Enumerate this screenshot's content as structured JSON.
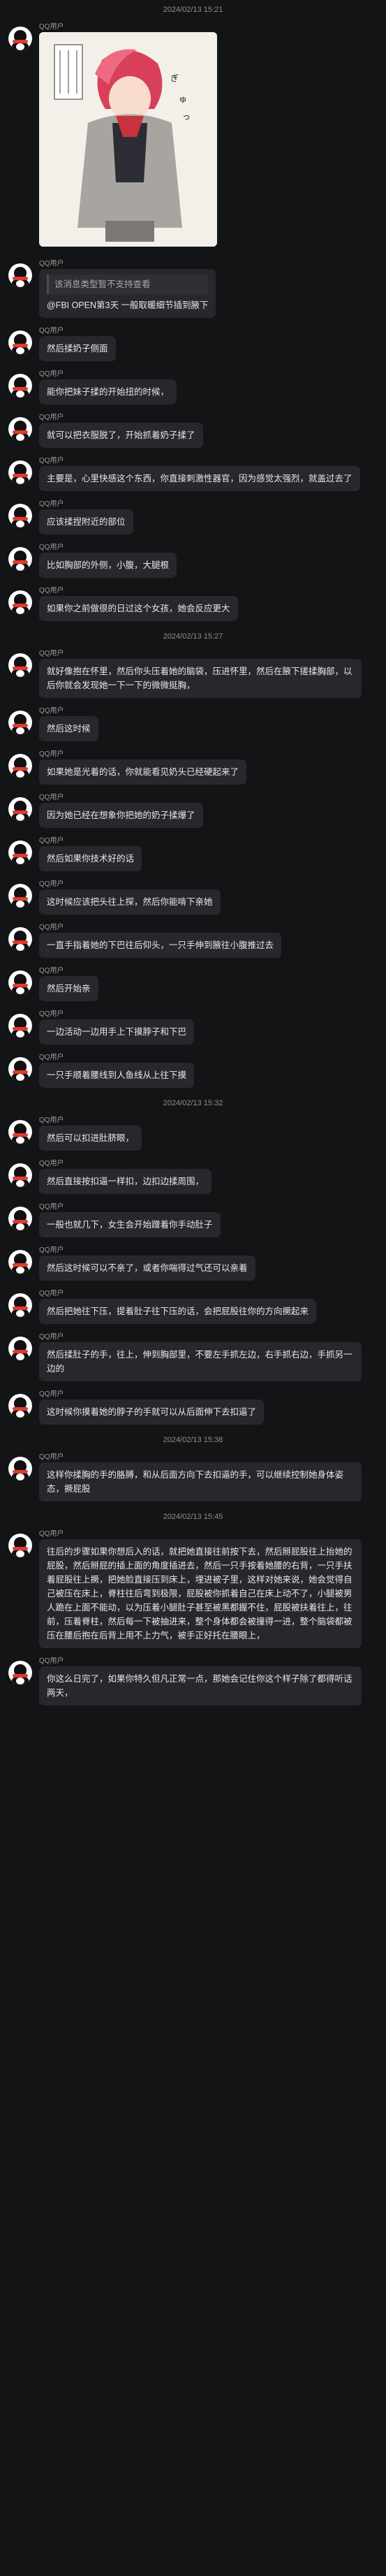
{
  "sender": "QQ用户",
  "timestamps": [
    "2024/02/13 15:21",
    "2024/02/13 15:27",
    "2024/02/13 15:32",
    "2024/02/13 15:38",
    "2024/02/13 15:45"
  ],
  "quote_notice": "该消息类型暂不支持查看",
  "messages": [
    "@FBI OPEN第3天 一般取暖细节插到腋下",
    "然后揉奶子侧面",
    "能你把妹子揉的开始扭的时候，",
    "就可以把衣服脱了，开始抓着奶子揉了",
    "主要是，心里快感这个东西，你直接刺激性器官，因为感觉太强烈，就盖过去了",
    "应该揉捏附近的部位",
    "比如胸部的外侧，小腹，大腿根",
    "如果你之前做很的日过这个女孩，她会反应更大",
    "就好像抱在怀里，然后你头压着她的脑袋，压进怀里，然后在腋下搓揉胸部，以后你就会发现她一下一下的微微挺胸，",
    "然后这时候",
    "如果她是光着的话，你就能看见奶头已经硬起来了",
    "因为她已经在想象你把她的奶子揉爆了",
    "然后如果你技术好的话",
    "这时候应该把头往上探，然后你能啃下亲她",
    "一直手指着她的下巴往后仰头，一只手伸到腋往小腹推过去",
    "然后开始亲",
    "一边活动一边用手上下摸脖子和下巴",
    "一只手顺着腰线到人鱼线从上往下摸",
    "然后可以扣进肚脐眼，",
    "然后直接按扣逼一样扣，边扣边揉周围，",
    "一般也就几下，女生会开始蹭着你手动肚子",
    "然后这时候可以不亲了，或者你喘得过气还可以亲着",
    "然后把她往下压，提着肚子往下压的话，会把屁股往你的方向撅起来",
    "然后揉肚子的手，往上，伸到胸部里，不要左手抓左边，右手抓右边，手抓另一边的",
    "这时候你摸着她的脖子的手就可以从后面伸下去扣逼了",
    "这样你揉胸的手的胳膊，和从后面方向下去扣逼的手，可以继续控制她身体姿态，撅屁股",
    "往后的步骤如果你想后入的话，就把她直接往前按下去，然后掰屁股往上抬她的屁股，然后掰屁的插上面的角度插进去，然后一只手按着她腰的右背，一只手扶着屁股往上撅，把她脸直接压到床上，埋进被子里，这样对她来说，她会觉得自己被压在床上，脊柱往后弯到极限，屁股被你抓着自己在床上动不了，小腿被男人跪在上面不能动，以为压着小腿肚子甚至被黑都握不住，屁股被扶着往上，往前，压着脊柱，然后每一下被抽进来，整个身体都会被撞得一进，整个脑袋都被压在腰后抱在后背上用不上力气，被手正好托在腰眼上，",
    "你这么日完了，如果你特久但凡正常一点，那她会记住你这个样子除了都得听话两天，"
  ]
}
